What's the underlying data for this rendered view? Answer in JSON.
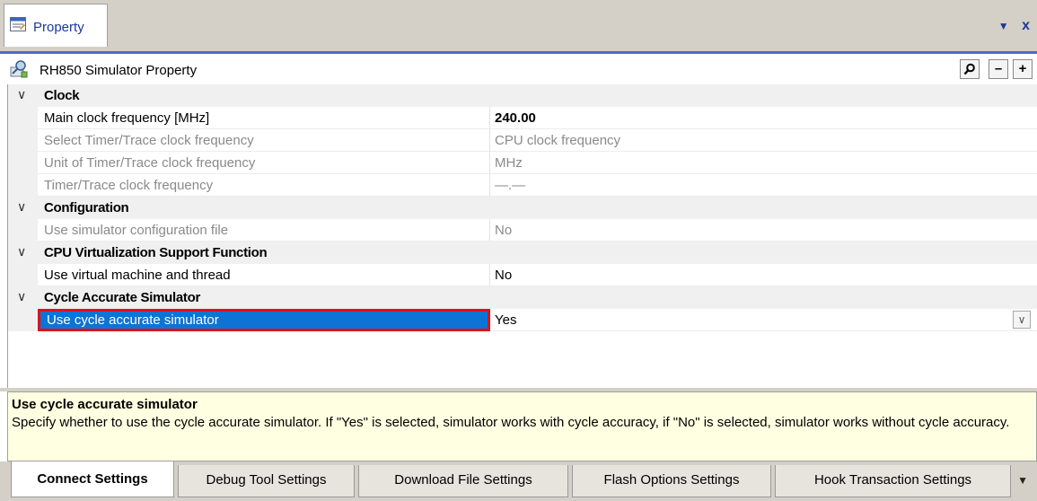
{
  "window": {
    "tab_title": "Property",
    "tab_icon": "property-window-icon",
    "controls": {
      "dropdown": "▼",
      "close": "x"
    }
  },
  "header": {
    "icon": "simulator-property-icon",
    "title": "RH850 Simulator Property",
    "search_icon": "search-icon",
    "collapse_label": "–",
    "expand_label": "+"
  },
  "grid": {
    "categories": [
      {
        "name": "Clock",
        "properties": [
          {
            "name": "Main clock frequency [MHz]",
            "value": "240.00",
            "enabled": true,
            "bold_value": true
          },
          {
            "name": "Select Timer/Trace clock frequency",
            "value": "CPU clock frequency",
            "enabled": false
          },
          {
            "name": "Unit of Timer/Trace clock frequency",
            "value": "MHz",
            "enabled": false
          },
          {
            "name": "Timer/Trace clock frequency",
            "value": "—.—",
            "enabled": false
          }
        ]
      },
      {
        "name": "Configuration",
        "properties": [
          {
            "name": "Use simulator configuration file",
            "value": "No",
            "enabled": false
          }
        ]
      },
      {
        "name": "CPU Virtualization Support Function",
        "properties": [
          {
            "name": "Use virtual machine and thread",
            "value": "No",
            "enabled": true
          }
        ]
      },
      {
        "name": "Cycle Accurate Simulator",
        "properties": [
          {
            "name": "Use cycle accurate simulator",
            "value": "Yes",
            "enabled": true,
            "selected": true
          }
        ]
      }
    ]
  },
  "description": {
    "title": "Use cycle accurate simulator",
    "body": "Specify whether to use the cycle accurate simulator. If \"Yes\" is selected, simulator works with cycle accuracy, if \"No\" is selected, simulator works without cycle accuracy."
  },
  "tabs": [
    {
      "label": "Connect Settings",
      "active": true
    },
    {
      "label": "Debug Tool Settings",
      "active": false
    },
    {
      "label": "Download File Settings",
      "active": false
    },
    {
      "label": "Flash Options Settings",
      "active": false
    },
    {
      "label": "Hook Transaction Settings",
      "active": false
    }
  ],
  "colors": {
    "selection": "#0c74d4",
    "highlight_border": "#e0101a",
    "description_bg": "#ffffe1",
    "title_text": "#1b3a9a"
  }
}
